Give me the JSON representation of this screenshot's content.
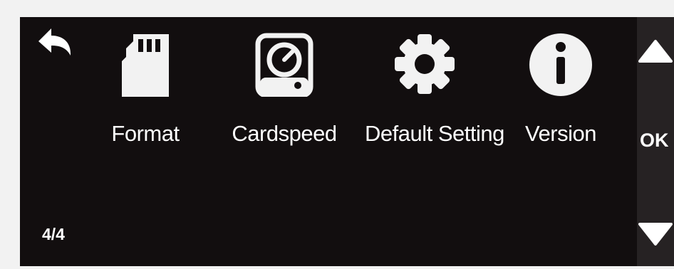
{
  "menu": {
    "items": [
      {
        "label": "Format",
        "icon": "sd-card-icon"
      },
      {
        "label": "Cardspeed",
        "icon": "card-speed-icon"
      },
      {
        "label": "Default Setting",
        "icon": "gear-icon"
      },
      {
        "label": "Version",
        "icon": "info-icon"
      }
    ]
  },
  "status": {
    "page": "4/4"
  },
  "side_panel": {
    "ok_label": "OK"
  },
  "colors": {
    "screen_bg": "#120e0f",
    "panel_bg": "#262223",
    "foreground": "#ffffff",
    "outer_bg": "#f2f2f2"
  }
}
